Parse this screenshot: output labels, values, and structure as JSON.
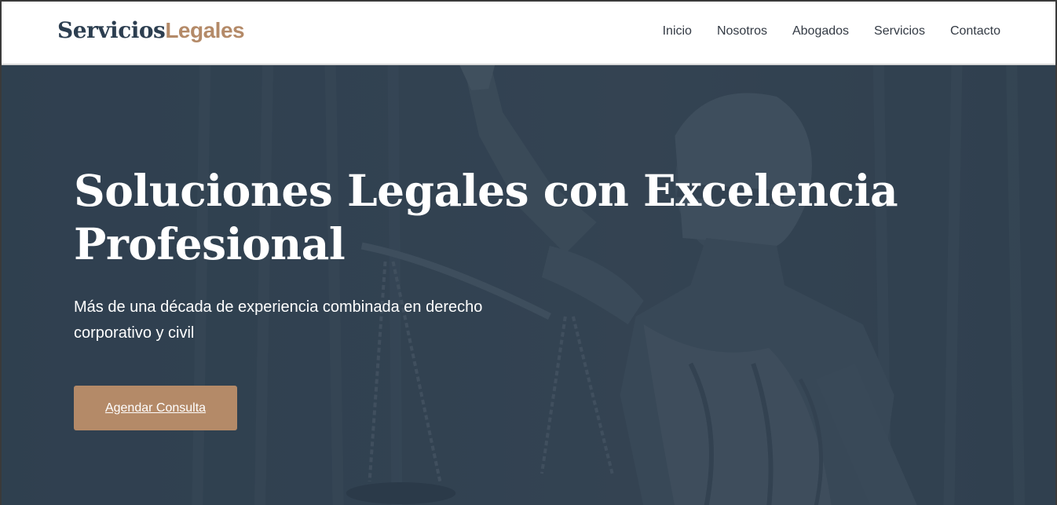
{
  "brand": {
    "part1": "Servicios",
    "part2": "Legales",
    "color_primary": "#2c3e50",
    "color_accent": "#b48a68"
  },
  "nav": {
    "items": [
      "Inicio",
      "Nosotros",
      "Abogados",
      "Servicios",
      "Contacto"
    ]
  },
  "hero": {
    "title": "Soluciones Legales con Excelencia Profesional",
    "subtitle": "Más de una década de experiencia combinada en derecho corporativo y civil",
    "cta_label": "Agendar Consulta",
    "background_image": "lady-justice-statue"
  }
}
